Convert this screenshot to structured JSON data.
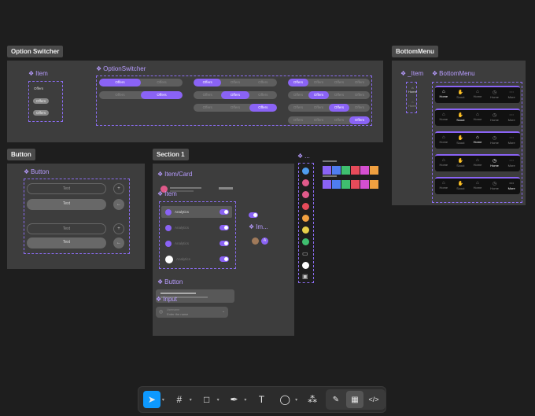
{
  "tags": {
    "option_switcher": "Option Switcher",
    "bottom_menu": "BottomMenu",
    "button": "Button",
    "section1": "Section 1"
  },
  "components": {
    "item": "Item",
    "option_switcher": "OptionSwitcher",
    "bm_item": "_Item",
    "bottom_menu": "BottomMenu",
    "button": "Button",
    "item_card": "Item/Card",
    "button2": "Button",
    "input": "Input",
    "image": "Im...",
    "icons": "..."
  },
  "option_switcher": {
    "item_label": "Offers",
    "seg_label": "Offers"
  },
  "bottom_menu": {
    "labels": [
      "Home",
      "Scout",
      "Home",
      "Home",
      "More"
    ]
  },
  "button_frame": {
    "text_label": "Text"
  },
  "section1": {
    "list_label": "Analytics",
    "input_placeholder": "Enter the name",
    "input_label": "Username"
  },
  "toolbar": {
    "tools": [
      "move-tool",
      "frame-tool",
      "shape-tool",
      "pen-tool",
      "text-tool",
      "comment-tool",
      "actions-tool",
      "draw-tool",
      "dev-mode-tool",
      "code-tool"
    ]
  },
  "colors": {
    "accent": "#8a63f5",
    "frame": "#3d3d3d",
    "canvas": "#1e1e1e",
    "swatches": [
      "#8a63f5",
      "#4f7df0",
      "#3fbf6f",
      "#e64b5a",
      "#d44fd0",
      "#f0a040"
    ]
  }
}
